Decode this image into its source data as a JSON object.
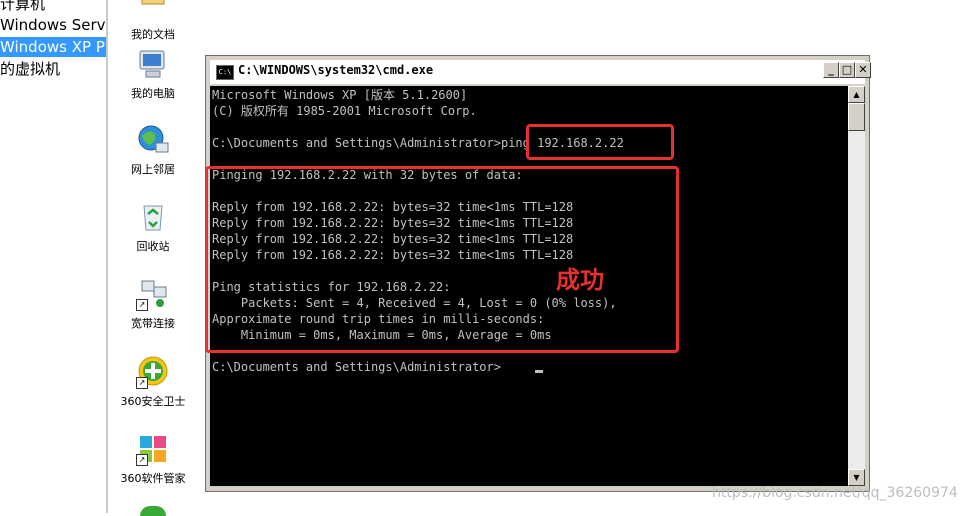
{
  "tree": {
    "items": [
      "计算机",
      "Windows Server",
      "Windows XP Pro",
      "的虚拟机"
    ],
    "selected_index": 2
  },
  "desktop": {
    "icons": [
      {
        "label": "我的文档",
        "icon": "my-documents-icon"
      },
      {
        "label": "我的电脑",
        "icon": "my-computer-icon"
      },
      {
        "label": "网上邻居",
        "icon": "network-places-icon"
      },
      {
        "label": "回收站",
        "icon": "recycle-bin-icon"
      },
      {
        "label": "宽带连接",
        "icon": "broadband-connection-icon"
      },
      {
        "label": "360安全卫士",
        "icon": "360-safeguard-icon"
      },
      {
        "label": "360软件管家",
        "icon": "360-software-manager-icon"
      }
    ]
  },
  "window": {
    "title": "C:\\WINDOWS\\system32\\cmd.exe",
    "icon_text": "C:\\"
  },
  "console": {
    "lines": [
      "Microsoft Windows XP [版本 5.1.2600]",
      "(C) 版权所有 1985-2001 Microsoft Corp.",
      "",
      "C:\\Documents and Settings\\Administrator>ping 192.168.2.22",
      "",
      "Pinging 192.168.2.22 with 32 bytes of data:",
      "",
      "Reply from 192.168.2.22: bytes=32 time<1ms TTL=128",
      "Reply from 192.168.2.22: bytes=32 time<1ms TTL=128",
      "Reply from 192.168.2.22: bytes=32 time<1ms TTL=128",
      "Reply from 192.168.2.22: bytes=32 time<1ms TTL=128",
      "",
      "Ping statistics for 192.168.2.22:",
      "    Packets: Sent = 4, Received = 4, Lost = 0 (0% loss),",
      "Approximate round trip times in milli-seconds:",
      "    Minimum = 0ms, Maximum = 0ms, Average = 0ms",
      "",
      "C:\\Documents and Settings\\Administrator>"
    ]
  },
  "annotation": {
    "success_label": "成功",
    "color": "#e8312f"
  },
  "watermark": "https://blog.csdn.net/qq_36260974"
}
